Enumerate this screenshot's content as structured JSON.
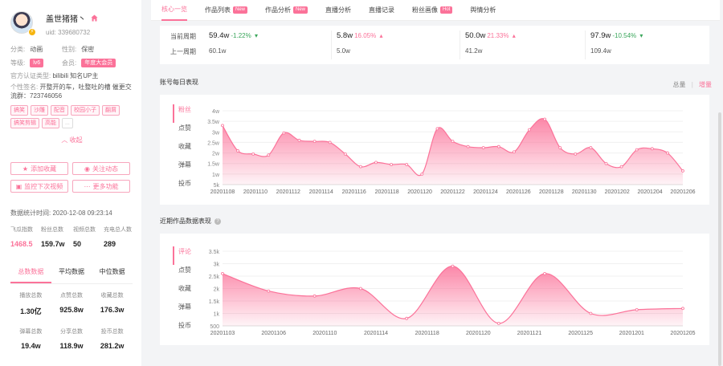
{
  "profile": {
    "name": "盖世猪猪丶",
    "uid": "uid: 339680732",
    "category_label": "分类:",
    "category": "动画",
    "gender_label": "性别:",
    "gender": "保密",
    "level_label": "等级:",
    "level": "lv6",
    "member_label": "会员:",
    "member": "年度大会员",
    "cert_label": "官方认证类型:",
    "cert": "bilibili 知名UP主",
    "sign_label": "个性签名:",
    "sign": "开整开的车，吐整吐的槽 催更交流群：723746056",
    "tags": [
      "搞笑",
      "沙雕",
      "配音",
      "校园小子",
      "翻屑",
      "搞笑剪辑",
      "高能",
      "..."
    ],
    "collapse": "收起"
  },
  "actions": [
    "添加收藏",
    "关注动态",
    "监控下次视频",
    "更多功能"
  ],
  "stats": {
    "time_label": "数据统计时间:",
    "time": "2020-12-08 09:23:14",
    "items": [
      {
        "label": "飞瓜指数",
        "value": "1468.5"
      },
      {
        "label": "粉丝总数",
        "value": "159.7w"
      },
      {
        "label": "视频总数",
        "value": "50"
      },
      {
        "label": "充电总人数",
        "value": "289"
      }
    ],
    "tabs": [
      "总数数据",
      "平均数据",
      "中位数据"
    ],
    "grid": [
      {
        "label": "播放总数",
        "value": "1.30亿"
      },
      {
        "label": "点赞总数",
        "value": "925.8w"
      },
      {
        "label": "收藏总数",
        "value": "176.3w"
      },
      {
        "label": "弹幕总数",
        "value": "19.4w"
      },
      {
        "label": "分享总数",
        "value": "118.9w"
      },
      {
        "label": "投币总数",
        "value": "281.2w"
      }
    ]
  },
  "tabs": [
    {
      "label": "核心一览",
      "badge": ""
    },
    {
      "label": "作品列表",
      "badge": "New"
    },
    {
      "label": "作品分析",
      "badge": "New"
    },
    {
      "label": "直播分析",
      "badge": ""
    },
    {
      "label": "直播记录",
      "badge": ""
    },
    {
      "label": "粉丝画像",
      "badge": "Hot"
    },
    {
      "label": "舆情分析",
      "badge": ""
    }
  ],
  "metrics": {
    "row_labels": [
      "当前周期",
      "上一周期"
    ],
    "cols": [
      {
        "current": "59.4w",
        "change": "-1.22%",
        "dir": "down",
        "previous": "60.1w"
      },
      {
        "current": "5.8w",
        "change": "16.05%",
        "dir": "up",
        "previous": "5.0w"
      },
      {
        "current": "50.0w",
        "change": "21.33%",
        "dir": "up",
        "previous": "41.2w"
      },
      {
        "current": "97.9w",
        "change": "-10.54%",
        "dir": "down",
        "previous": "109.4w"
      }
    ]
  },
  "daily_panel": {
    "title": "账号每日表现",
    "toggle_total": "总量",
    "toggle_sep": "|",
    "toggle_incr": "增量",
    "side_metrics": [
      "粉丝",
      "点赞",
      "收藏",
      "弹幕",
      "投币"
    ]
  },
  "recent_panel": {
    "title": "近期作品数据表现",
    "side_metrics": [
      "评论",
      "点赞",
      "收藏",
      "弹幕",
      "投币"
    ]
  },
  "chart_data": [
    {
      "type": "area",
      "y_ticks": [
        "5k",
        "1w",
        "1.5w",
        "2w",
        "2.5w",
        "3w",
        "3.5w",
        "4w"
      ],
      "ylim": [
        5000,
        40000
      ],
      "x_tick_labels": [
        "20201108",
        "20201110",
        "20201112",
        "20201114",
        "20201116",
        "20201118",
        "20201120",
        "20201122",
        "20201124",
        "20201126",
        "20201128",
        "20201130",
        "20201202",
        "20201204",
        "20201206"
      ],
      "values": [
        33000,
        21000,
        19500,
        19000,
        29500,
        26000,
        25500,
        25000,
        19500,
        13500,
        15500,
        14500,
        14500,
        10000,
        31500,
        25500,
        23000,
        22500,
        23000,
        20500,
        31000,
        36000,
        22500,
        19500,
        22500,
        15000,
        13500,
        21500,
        22000,
        20000,
        11500
      ],
      "color": "#fb7299"
    },
    {
      "type": "area",
      "y_ticks": [
        "500",
        "1k",
        "1.5k",
        "2k",
        "2.5k",
        "3k",
        "3.5k"
      ],
      "ylim": [
        500,
        3500
      ],
      "x_tick_labels": [
        "20201103",
        "20201106",
        "20201110",
        "20201114",
        "20201118",
        "20201120",
        "20201121",
        "20201125",
        "20201201",
        "20201205"
      ],
      "values": [
        2600,
        1900,
        1700,
        2000,
        800,
        2900,
        600,
        2600,
        1000,
        1150,
        1200
      ],
      "color": "#fb7299"
    }
  ]
}
